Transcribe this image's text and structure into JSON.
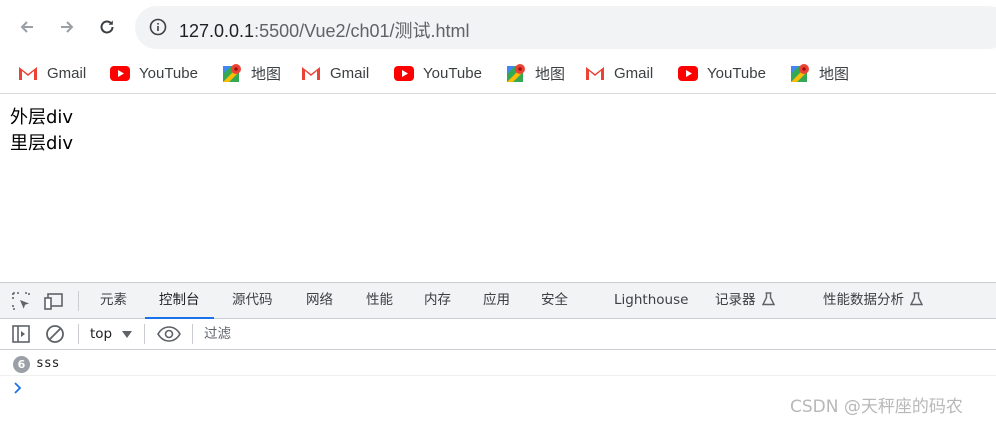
{
  "browser": {
    "url_host": "127.0.0.1",
    "url_path": ":5500/Vue2/ch01/测试.html"
  },
  "bookmarks": [
    {
      "label": "Gmail",
      "icon": "gmail-icon"
    },
    {
      "label": "YouTube",
      "icon": "youtube-icon"
    },
    {
      "label": "地图",
      "icon": "maps-icon"
    },
    {
      "label": "Gmail",
      "icon": "gmail-icon"
    },
    {
      "label": "YouTube",
      "icon": "youtube-icon"
    },
    {
      "label": "地图",
      "icon": "maps-icon"
    },
    {
      "label": "Gmail",
      "icon": "gmail-icon"
    },
    {
      "label": "YouTube",
      "icon": "youtube-icon"
    },
    {
      "label": "地图",
      "icon": "maps-icon"
    }
  ],
  "page": {
    "outer_div": "外层div",
    "inner_div": "里层div"
  },
  "devtools": {
    "tabs": [
      {
        "label": "元素"
      },
      {
        "label": "控制台",
        "active": true
      },
      {
        "label": "源代码"
      },
      {
        "label": "网络"
      },
      {
        "label": "性能"
      },
      {
        "label": "内存"
      },
      {
        "label": "应用"
      },
      {
        "label": "安全"
      },
      {
        "label": "Lighthouse"
      },
      {
        "label": "记录器"
      },
      {
        "label": "性能数据分析"
      }
    ],
    "console": {
      "context": "top",
      "filter_placeholder": "过滤",
      "messages": [
        {
          "repeat": "6",
          "text": "sss"
        }
      ]
    },
    "accent_color": "#1a73e8"
  },
  "watermark": "CSDN @天秤座的码农"
}
